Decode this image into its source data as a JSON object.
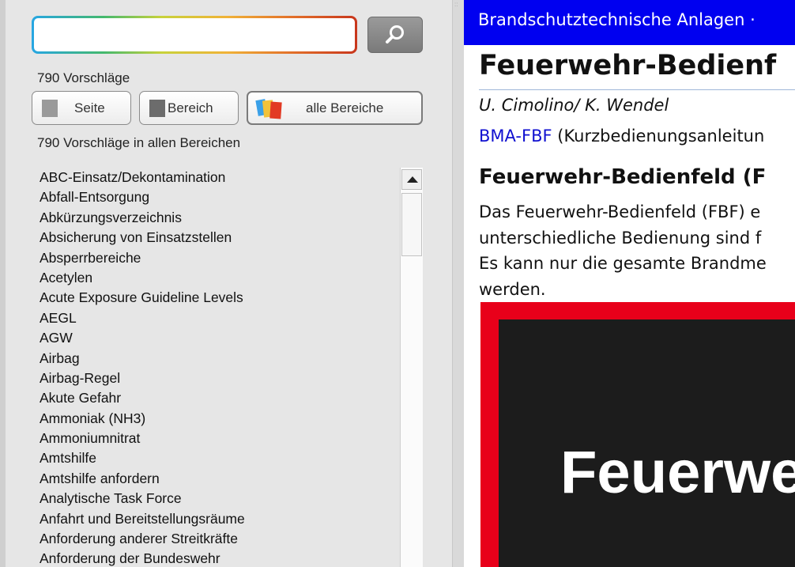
{
  "search": {
    "value": "",
    "placeholder": ""
  },
  "suggestions": {
    "count_label": "790 Vorschläge",
    "all_count_label": "790 Vorschläge in allen Bereichen"
  },
  "filters": {
    "page": "Seite",
    "range": "Bereich",
    "all": "alle Bereiche"
  },
  "list_items": [
    "ABC-Einsatz/Dekontamination",
    "Abfall-Entsorgung",
    "Abkürzungsverzeichnis",
    "Absicherung von Einsatzstellen",
    "Absperrbereiche",
    "Acetylen",
    "Acute Exposure Guideline Levels",
    "AEGL",
    "AGW",
    "Airbag",
    "Airbag-Regel",
    "Akute Gefahr",
    "Ammoniak (NH3)",
    "Ammoniumnitrat",
    "Amtshilfe",
    "Amtshilfe anfordern",
    "Analytische Task Force",
    "Anfahrt und Bereitstellungsräume",
    "Anforderung anderer Streitkräfte",
    "Anforderung der Bundeswehr"
  ],
  "article": {
    "breadcrumb": "Brandschutztechnische Anlagen ·",
    "title": "Feuerwehr-Bedienf",
    "authors": "U. Cimolino/ K. Wendel",
    "ref_link": "BMA-FBF",
    "ref_text": " (Kurzbedienungsanleitun",
    "heading": "Feuerwehr-Bedienfeld (F",
    "paragraph": [
      "Das Feuerwehr-Bedienfeld (FBF) e",
      "unterschiedliche Bedienung sind f",
      "Es kann nur die gesamte Brandme",
      "werden."
    ],
    "figure_text": "Feuerwe"
  },
  "colors": {
    "header_bar": "#0000f0",
    "link": "#1010d0",
    "figure_border": "#e8001a"
  },
  "icons": {
    "search_button": "magnifier-icon"
  }
}
